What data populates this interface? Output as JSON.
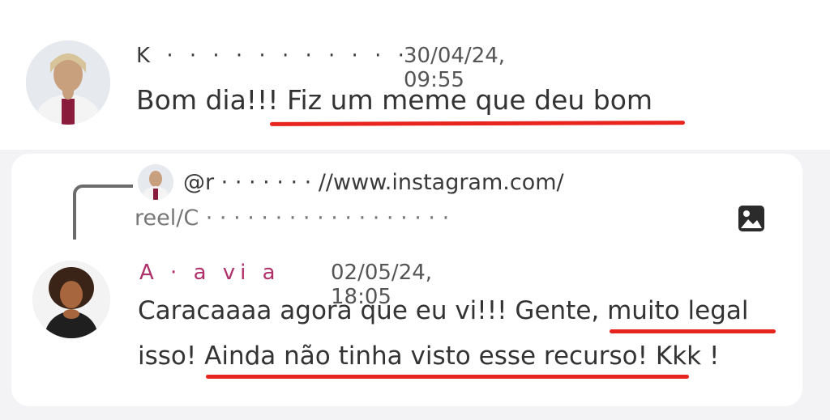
{
  "message1": {
    "author_redacted": "K  ·  ·   ·  ·  ·   ·  ·  ·  ·  ·  ·",
    "timestamp": "30/04/24, 09:55",
    "text": "Bom dia!!! Fiz um meme que deu bom"
  },
  "reply_preview": {
    "line1": "@r        ·    ·      ·       ·   ·  ·  ·  //www.instagram.com/",
    "line2": "reel/C  ·  ·  ·   ·   ·  ·   ·  ·  ·  ·  ·  ·  ·  ·  ·  ·  ·  ·"
  },
  "message2": {
    "author_redacted": "A    ·  a  vi  a",
    "timestamp": "02/05/24, 18:05",
    "text_line1": "Caracaaaa agora que eu vi!!! Gente, muito legal",
    "text_line2": "isso! Ainda não tinha visto esse recurso! Kkk !"
  },
  "icons": [
    "avatar",
    "image-icon"
  ],
  "colors": {
    "underline": "#e8241f",
    "author2": "#b0306a"
  }
}
